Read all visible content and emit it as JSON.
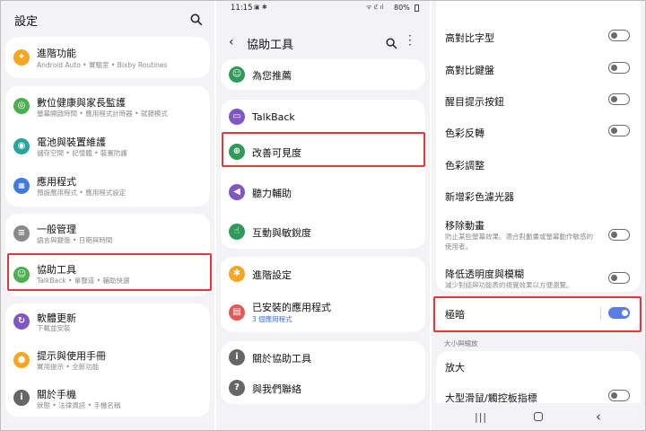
{
  "panel1": {
    "title": "設定",
    "items": [
      {
        "title": "進階功能",
        "subtitle": "Android Auto • 實驗室 • Bixby Routines",
        "icon": "star-gear-icon",
        "color": "#f5a623"
      },
      {
        "title": "數位健康與家長監護",
        "subtitle": "螢幕開啟時間 • 應用程式計時器 • 就寢模式",
        "icon": "wellbeing-icon",
        "color": "#4caf50"
      },
      {
        "title": "電池與裝置維護",
        "subtitle": "儲存空間 • 記憶體 • 裝置防護",
        "icon": "battery-care-icon",
        "color": "#26a69a"
      },
      {
        "title": "應用程式",
        "subtitle": "預設應用程式 • 應用程式設定",
        "icon": "apps-icon",
        "color": "#3f7be0"
      },
      {
        "title": "一般管理",
        "subtitle": "語言與鍵盤 • 日期與時間",
        "icon": "general-management-icon",
        "color": "#8a8a8a"
      },
      {
        "title": "協助工具",
        "subtitle": "TalkBack • 單聲道 • 輔助快選",
        "icon": "accessibility-icon",
        "color": "#4caf50"
      },
      {
        "title": "軟體更新",
        "subtitle": "下載並安裝",
        "icon": "software-update-icon",
        "color": "#7e57c2"
      },
      {
        "title": "提示與使用手冊",
        "subtitle": "實用提示 • 全新功能",
        "icon": "tips-icon",
        "color": "#f5a623"
      },
      {
        "title": "關於手機",
        "subtitle": "狀態 • 法律資訊 • 手機名稱",
        "icon": "info-icon",
        "color": "#666666"
      }
    ]
  },
  "panel2": {
    "status_time": "11:15",
    "status_battery": "80%",
    "title": "協助工具",
    "items": [
      {
        "title": "為您推薦",
        "icon": "recommended-icon",
        "color": "#2e9b5a"
      },
      {
        "title": "TalkBack",
        "icon": "talkback-icon",
        "color": "#7e57c2"
      },
      {
        "title": "改善可見度",
        "icon": "visibility-enhancement-icon",
        "color": "#2e9b5a"
      },
      {
        "title": "聽力輔助",
        "icon": "hearing-icon",
        "color": "#7e57c2"
      },
      {
        "title": "互動與敏銳度",
        "icon": "interaction-icon",
        "color": "#2e9b5a"
      },
      {
        "title": "進階設定",
        "icon": "advanced-settings-icon",
        "color": "#f5a623"
      },
      {
        "title": "已安裝的應用程式",
        "subtitle": "3 個應用程式",
        "icon": "installed-apps-icon",
        "color": "#e05a5a"
      },
      {
        "title": "關於協助工具",
        "icon": "about-icon",
        "color": "#666666"
      },
      {
        "title": "與我們聯絡",
        "icon": "contact-icon",
        "color": "#666666"
      }
    ]
  },
  "panel3": {
    "items": [
      {
        "title": "高對比字型",
        "toggle": false
      },
      {
        "title": "高對比鍵盤",
        "toggle": false
      },
      {
        "title": "醒目提示按鈕",
        "toggle": false
      },
      {
        "title": "色彩反轉",
        "toggle": false
      },
      {
        "title": "色彩調整"
      },
      {
        "title": "新增彩色濾光器"
      },
      {
        "title": "移除動畫",
        "subtitle": "防止某些螢幕效果。適合對動畫或螢幕動作敏感的使用者。",
        "toggle": false
      },
      {
        "title": "降低透明度與模糊",
        "subtitle": "減少對話與功能表的視覺效果以方便瀏覽。",
        "toggle": false
      },
      {
        "title": "極暗",
        "toggle": true
      }
    ],
    "section_label": "大小與縮放",
    "items2": [
      {
        "title": "放大"
      },
      {
        "title": "大型滑鼠/觸控板指標",
        "toggle": false
      }
    ]
  }
}
